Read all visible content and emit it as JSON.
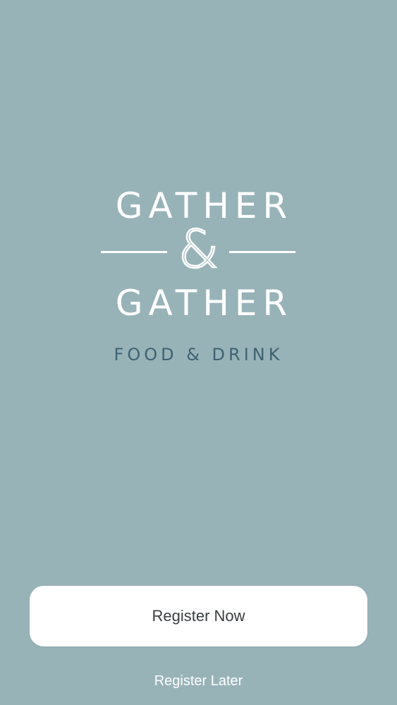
{
  "brand": {
    "line1": "GATHER",
    "ampersand": "&",
    "line2": "GATHER",
    "tagline": "FOOD & DRINK"
  },
  "actions": {
    "register_now_label": "Register Now",
    "register_later_label": "Register Later"
  },
  "colors": {
    "background": "#98b3b8",
    "logo": "#ffffff",
    "tagline": "#3e6272",
    "button_bg": "#ffffff",
    "button_text": "#3a3d3f"
  }
}
